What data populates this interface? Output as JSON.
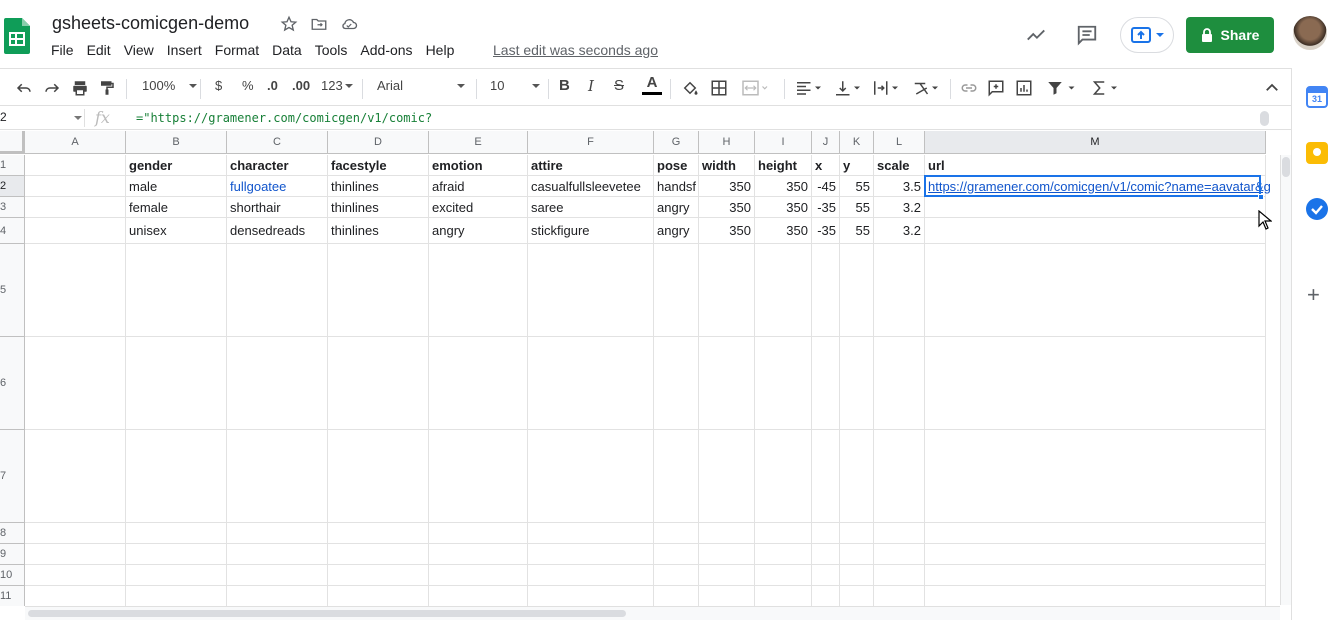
{
  "doc": {
    "title": "gsheets-comicgen-demo",
    "menu": [
      "File",
      "Edit",
      "View",
      "Insert",
      "Format",
      "Data",
      "Tools",
      "Add-ons",
      "Help"
    ],
    "last_edit": "Last edit was seconds ago",
    "share_label": "Share"
  },
  "toolbar": {
    "zoom": "100%",
    "currency": "$",
    "percent": "%",
    "dec_less": ".0",
    "dec_more": ".00",
    "format_more": "123",
    "font": "Arial",
    "font_size": "10"
  },
  "formula_bar": {
    "name_box": "2",
    "fx_label": "fx",
    "content": "=\"https://gramener.com/comicgen/v1/comic?"
  },
  "sheet": {
    "columns": [
      "A",
      "B",
      "C",
      "D",
      "E",
      "F",
      "G",
      "H",
      "I",
      "J",
      "K",
      "L",
      "M"
    ],
    "rows": [
      "1",
      "2",
      "3",
      "4",
      "5",
      "6",
      "7",
      "8",
      "9",
      "10",
      "11"
    ],
    "header_row": [
      "gender",
      "character",
      "facestyle",
      "emotion",
      "attire",
      "pose",
      "width",
      "height",
      "x",
      "y",
      "scale",
      "url"
    ],
    "data": [
      [
        "male",
        "fullgoatee",
        "thinlines",
        "afraid",
        "casualfullsleevetee",
        "handsf",
        "350",
        "350",
        "-45",
        "55",
        "3.5",
        "https://gramener.com/comicgen/v1/comic?name=aavatar&g"
      ],
      [
        "female",
        "shorthair",
        "thinlines",
        "excited",
        "saree",
        "angry",
        "350",
        "350",
        "-35",
        "55",
        "3.2",
        ""
      ],
      [
        "unisex",
        "densedreads",
        "thinlines",
        "angry",
        "stickfigure",
        "angry",
        "350",
        "350",
        "-35",
        "55",
        "3.2",
        ""
      ]
    ],
    "selected_cell": "M2"
  },
  "colors": {
    "accent": "#1a73e8",
    "share_green": "#1e8e3e",
    "link_blue": "#1155cc",
    "formula_green": "#188038"
  }
}
